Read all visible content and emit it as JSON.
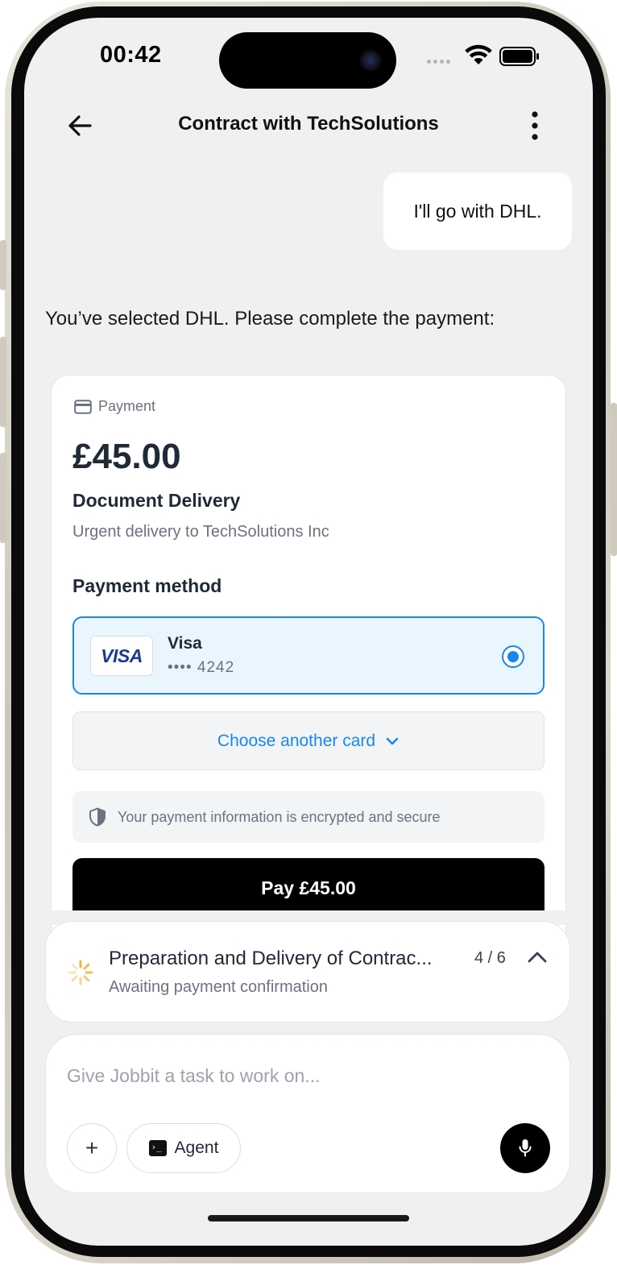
{
  "status_bar": {
    "time": "00:42"
  },
  "header": {
    "title": "Contract with TechSolutions",
    "back_icon": "arrow-left-icon",
    "more_icon": "more-vertical-icon"
  },
  "chat": {
    "user_message": "I'll go with DHL.",
    "assistant_message": "You’ve selected DHL. Please complete the payment:"
  },
  "payment": {
    "label": "Payment",
    "amount": "£45.00",
    "item_title": "Document Delivery",
    "item_description": "Urgent delivery to TechSolutions Inc",
    "method_heading": "Payment method",
    "card": {
      "brand_logo": "VISA",
      "name": "Visa",
      "number": "•••• 4242",
      "selected": true
    },
    "choose_another_label": "Choose another card",
    "secure_note": "Your payment information is encrypted and secure",
    "pay_button_label": "Pay £45.00",
    "accent_color": "#1a86f0"
  },
  "task": {
    "title": "Preparation and Delivery of Contrac...",
    "status": "Awaiting payment confirmation",
    "progress": "4 / 6",
    "spinner_color": "#f5b041"
  },
  "composer": {
    "placeholder": "Give Jobbit a task to work on...",
    "plus_label": "+",
    "agent_label": "Agent"
  }
}
